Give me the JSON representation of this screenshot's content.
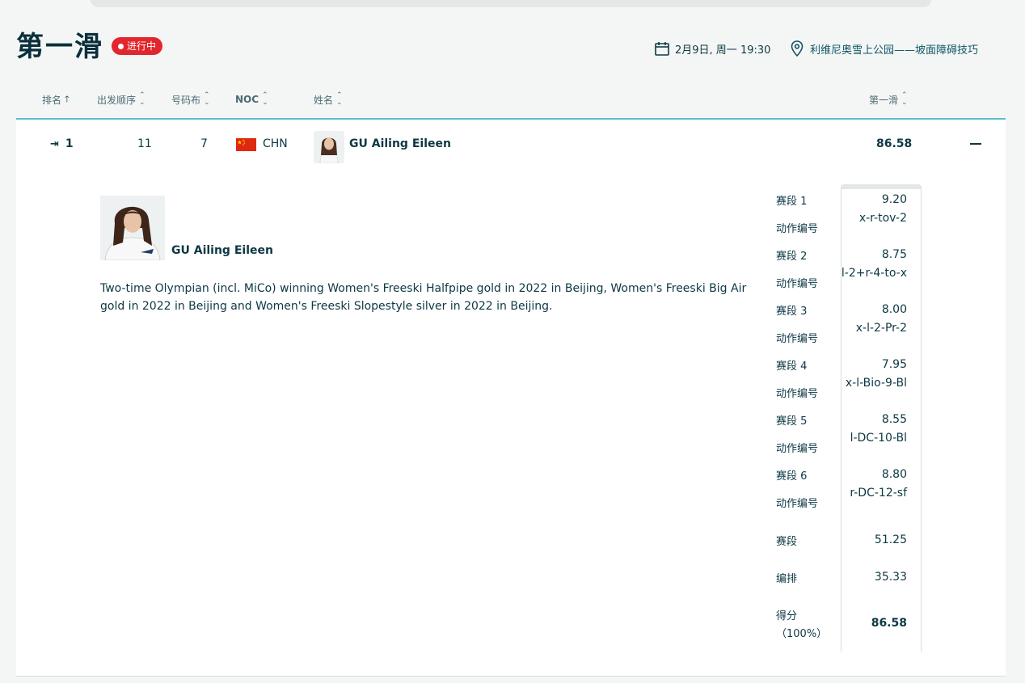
{
  "header": {
    "title": "第一滑",
    "live_label": "进行中",
    "date": "2月9日, 周一 19:30",
    "venue": "利维尼奥雪上公园——坡面障碍技巧"
  },
  "columns": {
    "rank": "排名",
    "start_order": "出发顺序",
    "bib": "号码布",
    "noc": "NOC",
    "name": "姓名",
    "run": "第一滑"
  },
  "row": {
    "rank": "1",
    "start_order": "11",
    "bib": "7",
    "noc": "CHN",
    "name": "GU Ailing Eileen",
    "score": "86.58"
  },
  "bio": {
    "name": "GU Ailing Eileen",
    "text": "Two-time Olympian (incl. MiCo) winning Women's Freeski Halfpipe gold in 2022 in Beijing, Women's Freeski Big Air gold in 2022 in Beijing and Women's Freeski Slopestyle silver in 2022 in Beijing."
  },
  "sections": [
    {
      "label": "赛段 1",
      "score": "9.20",
      "trick_label": "动作编号",
      "trick": "x-r-tov-2"
    },
    {
      "label": "赛段 2",
      "score": "8.75",
      "trick_label": "动作编号",
      "trick": "l-2+r-4-to-x"
    },
    {
      "label": "赛段 3",
      "score": "8.00",
      "trick_label": "动作编号",
      "trick": "x-l-2-Pr-2"
    },
    {
      "label": "赛段 4",
      "score": "7.95",
      "trick_label": "动作编号",
      "trick": "x-l-Bio-9-Bl"
    },
    {
      "label": "赛段 5",
      "score": "8.55",
      "trick_label": "动作编号",
      "trick": "l-DC-10-Bl"
    },
    {
      "label": "赛段 6",
      "score": "8.80",
      "trick_label": "动作编号",
      "trick": "r-DC-12-sf"
    }
  ],
  "totals": {
    "sections_label": "赛段",
    "sections_value": "51.25",
    "composition_label": "编排",
    "composition_value": "35.33",
    "score_label": "得分",
    "score_pct": "（100%）",
    "score_value": "86.58"
  },
  "colors": {
    "live": "#e2262d",
    "accent_line": "#56c2cb",
    "text": "#0d3844"
  }
}
